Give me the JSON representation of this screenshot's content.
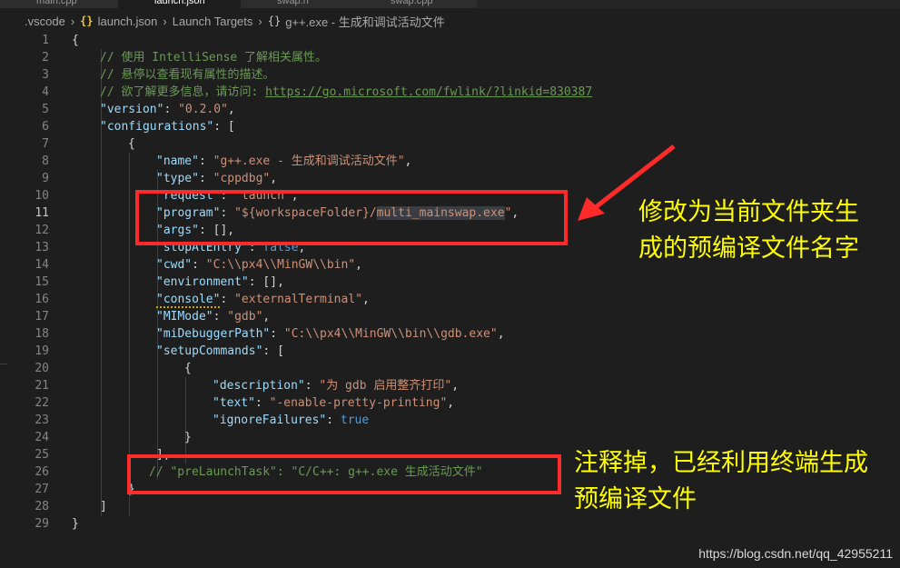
{
  "tabs": [
    {
      "label": "main.cpp"
    },
    {
      "label": "launch.json"
    },
    {
      "label": "swap.h"
    },
    {
      "label": "swap.cpp"
    }
  ],
  "breadcrumb": {
    "folder": ".vscode",
    "file": "launch.json",
    "section": "Launch Targets",
    "item": "g++.exe - 生成和调试活动文件"
  },
  "code": {
    "l1": "{",
    "l2": "// 使用 IntelliSense 了解相关属性。",
    "l3": "// 悬停以查看现有属性的描述。",
    "l4a": "// 欲了解更多信息，请访问: ",
    "l4b": "https://go.microsoft.com/fwlink/?linkid=830387",
    "l5k": "\"version\"",
    "l5v": "\"0.2.0\"",
    "l6k": "\"configurations\"",
    "l6v": "[",
    "l7": "{",
    "l8k": "\"name\"",
    "l8v": "\"g++.exe - 生成和调试活动文件\"",
    "l9k": "\"type\"",
    "l9v": "\"cppdbg\"",
    "l10k": "\"request\"",
    "l10v": "\"launch\"",
    "l11k": "\"program\"",
    "l11v1": "\"${workspaceFolder}/",
    "l11v2": "multi_mainswap.exe",
    "l11v3": "\"",
    "l12k": "\"args\"",
    "l12v": "[]",
    "l13k": "\"stopAtEntry\"",
    "l13v": "false",
    "l14k": "\"cwd\"",
    "l14v": "\"C:\\\\px4\\\\MinGW\\\\bin\"",
    "l15k": "\"environment\"",
    "l15v": "[]",
    "l16k": "\"console\"",
    "l16v": "\"externalTerminal\"",
    "l17k": "\"MIMode\"",
    "l17v": "\"gdb\"",
    "l18k": "\"miDebuggerPath\"",
    "l18v": "\"C:\\\\px4\\\\MinGW\\\\bin\\\\gdb.exe\"",
    "l19k": "\"setupCommands\"",
    "l19v": "[",
    "l20": "{",
    "l21k": "\"description\"",
    "l21v": "\"为 gdb 启用整齐打印\"",
    "l22k": "\"text\"",
    "l22v": "\"-enable-pretty-printing\"",
    "l23k": "\"ignoreFailures\"",
    "l23v": "true",
    "l24": "}",
    "l25": "],",
    "l26": "// \"preLaunchTask\": \"C/C++: g++.exe 生成活动文件\"",
    "l27": "}",
    "l28": "]",
    "l29": "}"
  },
  "annotations": {
    "a1_line1": "修改为当前文件夹生",
    "a1_line2": "成的预编译文件名字",
    "a2_line1": "注释掉，已经利用终端生成",
    "a2_line2": "预编译文件"
  },
  "watermark": "https://blog.csdn.net/qq_42955211",
  "colors": {
    "key": "#9cdcfe",
    "string": "#ce9178",
    "comment": "#6a9955",
    "keyword": "#569cd6",
    "annotation": "#ffff00",
    "box": "#ff2a2a"
  }
}
